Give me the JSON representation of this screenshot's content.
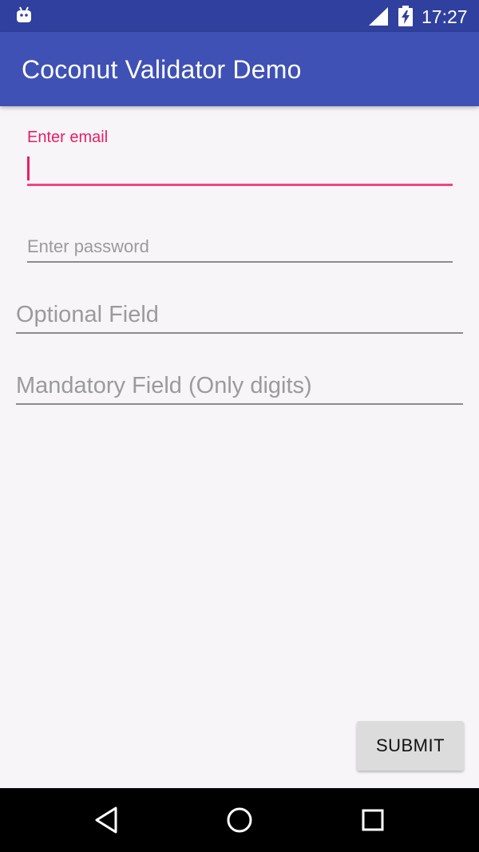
{
  "status_bar": {
    "time": "17:27",
    "icons": [
      "android-icon",
      "signal-icon",
      "battery-charging-icon"
    ]
  },
  "app_bar": {
    "title": "Coconut Validator Demo"
  },
  "form": {
    "email": {
      "label": "Enter email",
      "value": ""
    },
    "password": {
      "placeholder": "Enter password",
      "value": ""
    },
    "optional": {
      "placeholder": "Optional Field",
      "value": ""
    },
    "mandatory": {
      "placeholder": "Mandatory Field (Only digits)",
      "value": ""
    },
    "submit_label": "SUBMIT"
  },
  "nav_bar": {
    "icons": [
      "back-icon",
      "home-icon",
      "recents-icon"
    ]
  },
  "colors": {
    "primary": "#3f51b5",
    "primary_dark": "#30409e",
    "accent": "#e91e63"
  }
}
